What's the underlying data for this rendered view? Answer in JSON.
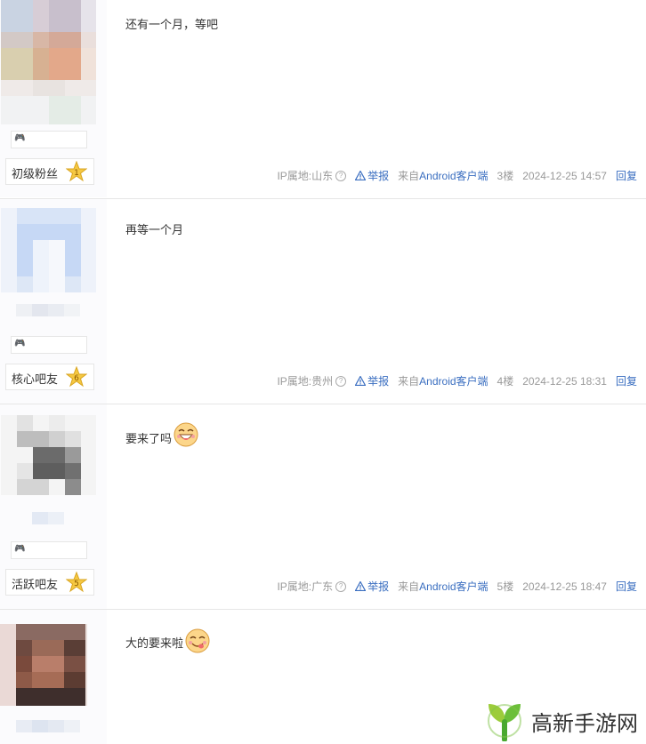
{
  "posts": [
    {
      "content": "还有一个月，等吧",
      "level_name": "初级粉丝",
      "level_num": "1",
      "ip_location": "IP属地:山东",
      "report_label": "举报",
      "from_prefix": "来自",
      "from_client": "Android客户端",
      "floor": "3楼",
      "time": "2024-12-25 14:57",
      "reply_label": "回复"
    },
    {
      "content": "再等一个月",
      "level_name": "核心吧友",
      "level_num": "6",
      "ip_location": "IP属地:贵州",
      "report_label": "举报",
      "from_prefix": "来自",
      "from_client": "Android客户端",
      "floor": "4楼",
      "time": "2024-12-25 18:31",
      "reply_label": "回复"
    },
    {
      "content": "要来了吗",
      "emoji": "grin-emoji",
      "level_name": "活跃吧友",
      "level_num": "5",
      "ip_location": "IP属地:广东",
      "report_label": "举报",
      "from_prefix": "来自",
      "from_client": "Android客户端",
      "floor": "5楼",
      "time": "2024-12-25 18:47",
      "reply_label": "回复"
    },
    {
      "content": "大的要来啦",
      "emoji": "yummy-emoji"
    }
  ],
  "watermark": {
    "text": "高新手游网",
    "logo": "leaf-y-logo"
  },
  "colors": {
    "link": "#3a6ec0",
    "meta": "#999999",
    "star": "#f5c842",
    "sidebar": "#fbfbfd"
  }
}
